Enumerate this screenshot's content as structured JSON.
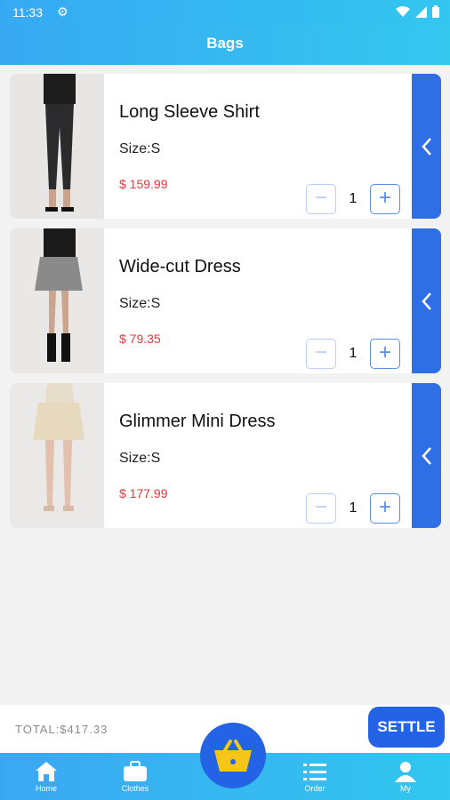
{
  "status_bar": {
    "time": "11:33",
    "icons": [
      "settings-icon",
      "wifi-icon",
      "signal-icon",
      "battery-icon"
    ]
  },
  "header": {
    "title": "Bags"
  },
  "items": [
    {
      "name": "Long Sleeve Shirt",
      "size": "Size:S",
      "price": "$ 159.99",
      "qty": "1",
      "image": "black-jeans-model-photo"
    },
    {
      "name": "Wide-cut Dress",
      "size": "Size:S",
      "price": "$ 79.35",
      "qty": "1",
      "image": "plaid-skirt-model-photo"
    },
    {
      "name": "Glimmer Mini Dress",
      "size": "Size:S",
      "price": "$ 177.99",
      "qty": "1",
      "image": "beige-skirt-model-photo"
    }
  ],
  "footer": {
    "total": "TOTAL:$417.33",
    "settle_label": "SETTLE"
  },
  "tabs": [
    {
      "label": "Home",
      "icon": "home-icon"
    },
    {
      "label": "Clothes",
      "icon": "bag-icon"
    },
    {
      "label": "Order",
      "icon": "list-icon"
    },
    {
      "label": "My",
      "icon": "user-icon"
    }
  ],
  "fab": {
    "icon": "basket-icon"
  },
  "colors": {
    "accent": "#2563e6",
    "header_gradient_start": "#37a8f1",
    "header_gradient_end": "#35c8ef",
    "price": "#e5373b"
  }
}
